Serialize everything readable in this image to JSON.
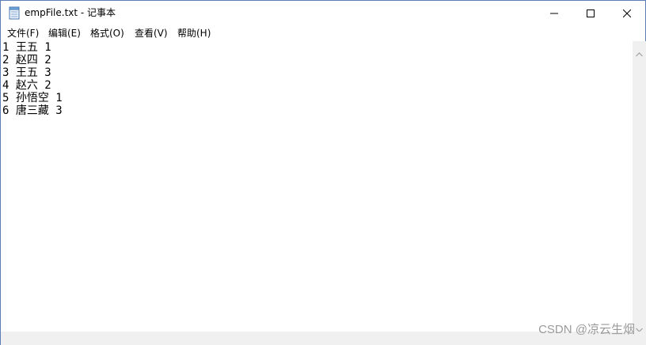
{
  "window": {
    "title": "empFile.txt - 记事本"
  },
  "icons": {
    "app": "notepad-icon",
    "minimize": "minimize-icon",
    "maximize": "maximize-icon",
    "close": "close-icon",
    "scroll_up": "chevron-up-icon",
    "scroll_down": "chevron-down-icon"
  },
  "menu": [
    {
      "label": "文件(F)"
    },
    {
      "label": "编辑(E)"
    },
    {
      "label": "格式(O)"
    },
    {
      "label": "查看(V)"
    },
    {
      "label": "帮助(H)"
    }
  ],
  "content": {
    "lines": [
      "1 王五 1",
      "2 赵四 2",
      "3 王五 3",
      "4 赵六 2",
      "5 孙悟空 1",
      "6 唐三藏 3"
    ]
  },
  "watermark": "CSDN @凉云生烟"
}
